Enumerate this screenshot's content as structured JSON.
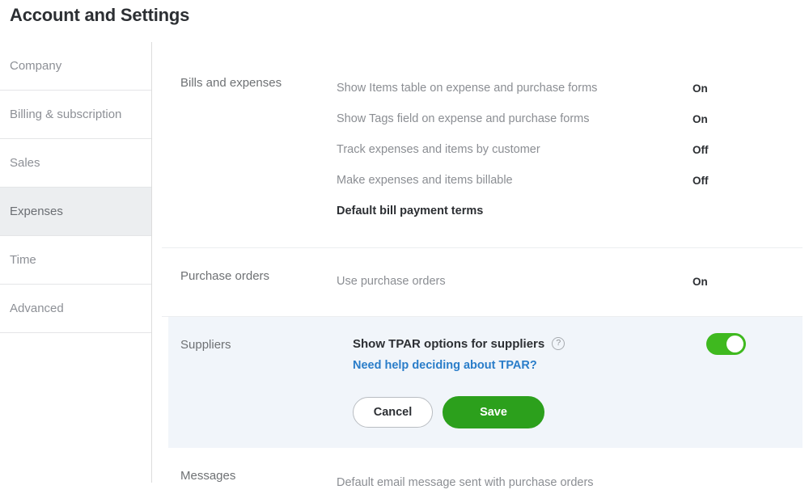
{
  "page": {
    "title": "Account and Settings"
  },
  "sidebar": {
    "items": [
      {
        "label": "Company",
        "active": false
      },
      {
        "label": "Billing & subscription",
        "active": false
      },
      {
        "label": "Sales",
        "active": false
      },
      {
        "label": "Expenses",
        "active": true
      },
      {
        "label": "Time",
        "active": false
      },
      {
        "label": "Advanced",
        "active": false
      }
    ]
  },
  "sections": {
    "bills": {
      "label": "Bills and expenses",
      "rows": [
        {
          "text": "Show Items table on expense and purchase forms",
          "state": "On"
        },
        {
          "text": "Show Tags field on expense and purchase forms",
          "state": "On"
        },
        {
          "text": "Track expenses and items by customer",
          "state": "Off"
        },
        {
          "text": "Make expenses and items billable",
          "state": "Off"
        }
      ],
      "subheading": "Default bill payment terms"
    },
    "purchase_orders": {
      "label": "Purchase orders",
      "rows": [
        {
          "text": "Use purchase orders",
          "state": "On"
        }
      ]
    },
    "suppliers": {
      "label": "Suppliers",
      "option_title": "Show TPAR options for suppliers",
      "help_icon": "question-mark-icon",
      "help_glyph": "?",
      "help_link": "Need help deciding about TPAR?",
      "toggle_state": "on",
      "cancel_label": "Cancel",
      "save_label": "Save"
    },
    "messages": {
      "label": "Messages",
      "rows": [
        {
          "text": "Default email message sent with purchase orders",
          "state": ""
        }
      ]
    }
  },
  "colors": {
    "save_green": "#2ca01c",
    "toggle_green": "#3fb91f",
    "link_blue": "#2a7dc9",
    "panel_highlight": "#f1f5fa",
    "sidebar_active": "#eceef0"
  }
}
